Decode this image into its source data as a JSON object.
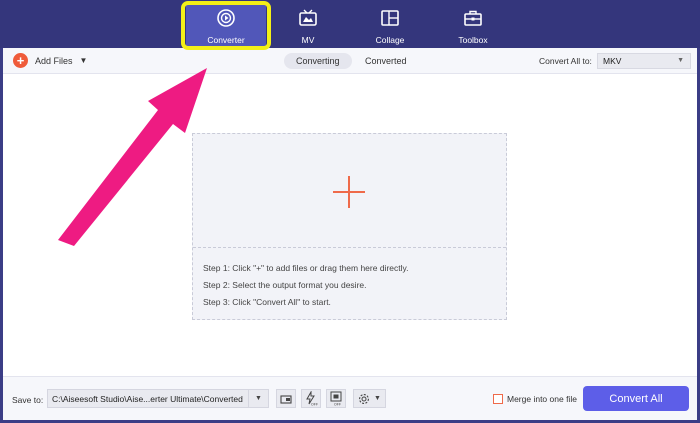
{
  "nav": {
    "tabs": [
      {
        "label": "Converter",
        "icon": "converter-icon"
      },
      {
        "label": "MV",
        "icon": "mv-icon"
      },
      {
        "label": "Collage",
        "icon": "collage-icon"
      },
      {
        "label": "Toolbox",
        "icon": "toolbox-icon"
      }
    ],
    "active_tab": "Converter"
  },
  "toolbar": {
    "add_files_label": "Add Files",
    "segments": [
      "Converting",
      "Converted"
    ],
    "active_segment": "Converting",
    "convert_all_to_label": "Convert All to:",
    "format_value": "MKV"
  },
  "dropzone": {
    "steps": [
      "Step 1: Click \"+\" to add files or drag them here directly.",
      "Step 2: Select the output format you desire.",
      "Step 3: Click \"Convert All\" to start."
    ]
  },
  "bottom": {
    "save_to_label": "Save to:",
    "path_value": "C:\\Aiseesoft Studio\\Aise...erter Ultimate\\Converted",
    "merge_label": "Merge into one file",
    "merge_checked": false,
    "convert_all_label": "Convert All"
  },
  "colors": {
    "nav_bg": "#34367c",
    "active_tab_bg": "#5157b9",
    "highlight_border": "#f3f017",
    "annotation_arrow": "#ee1b82",
    "accent_orange": "#ef5b3a",
    "convert_button": "#5d5ee8"
  }
}
